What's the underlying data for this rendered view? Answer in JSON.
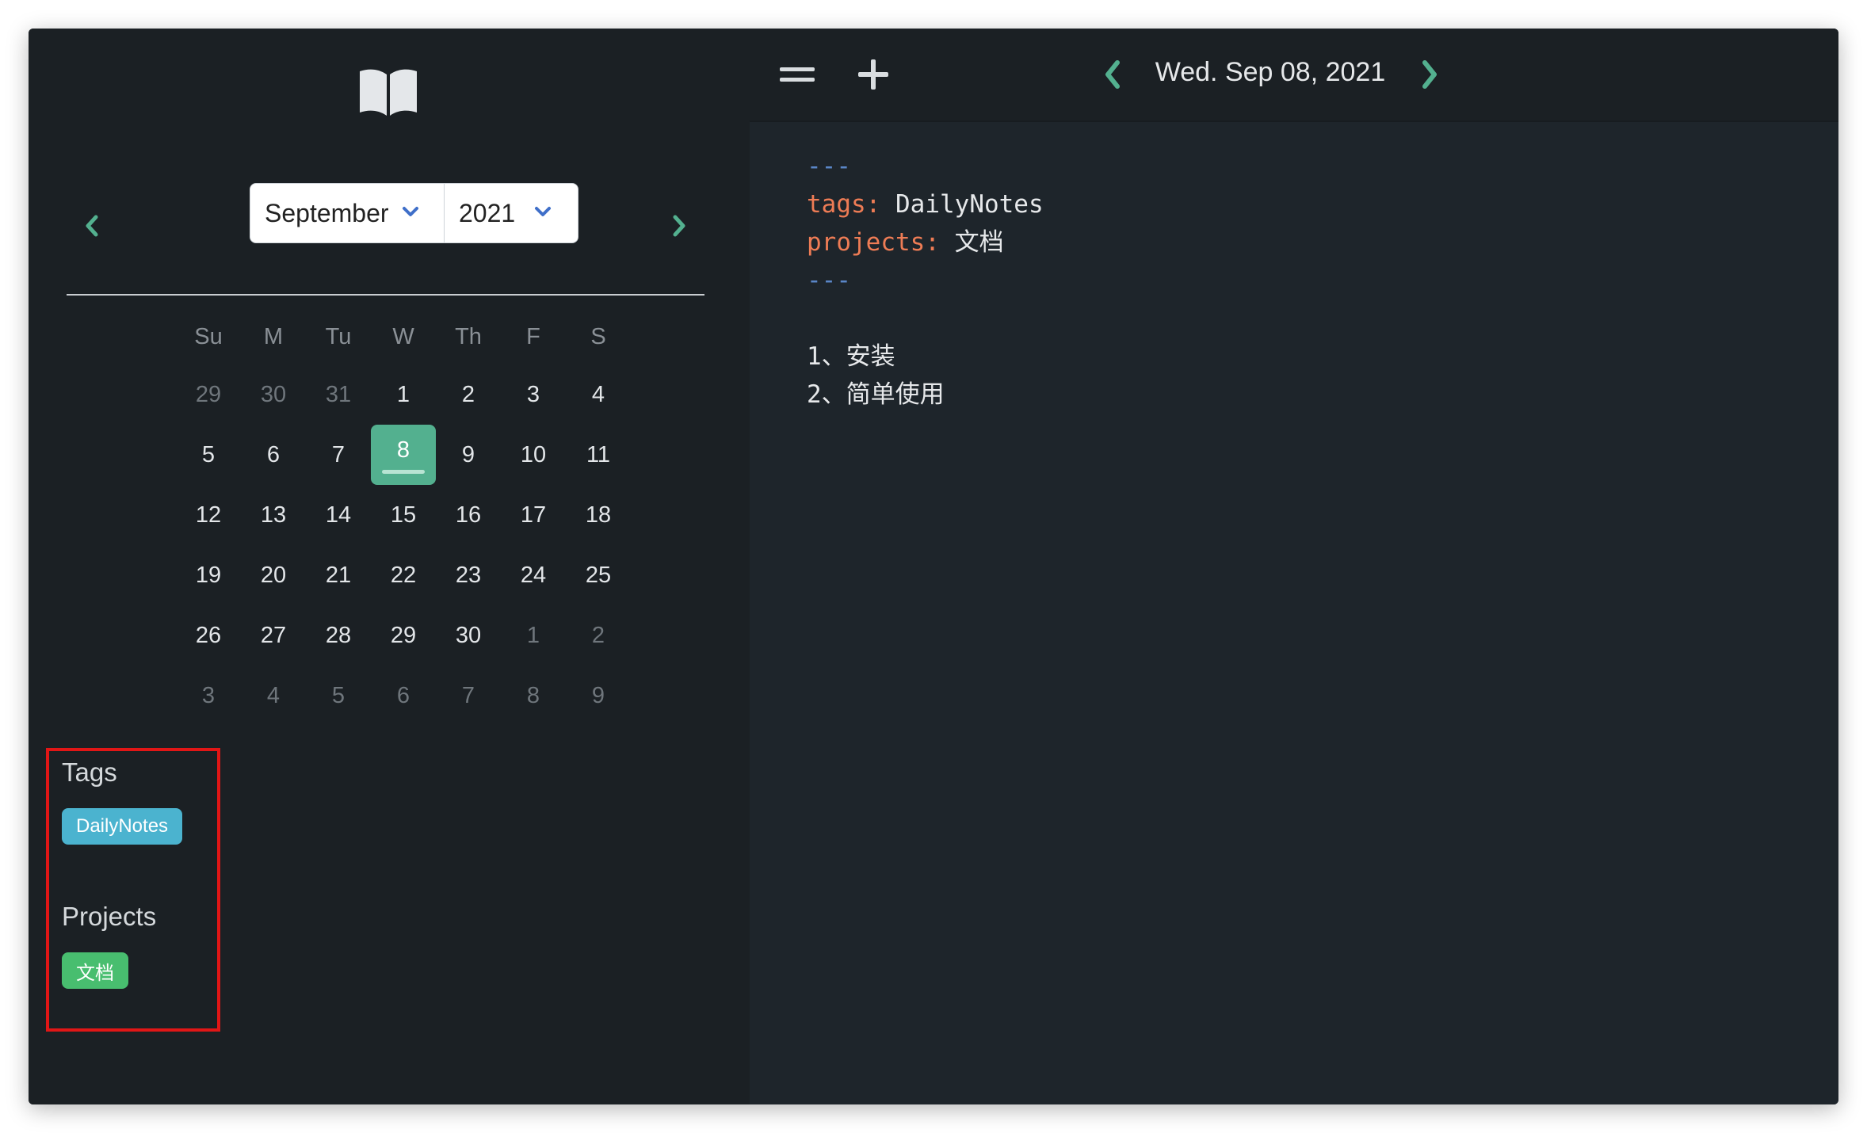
{
  "calendar": {
    "month": "September",
    "year": "2021",
    "weekdays": [
      "Su",
      "M",
      "Tu",
      "W",
      "Th",
      "F",
      "S"
    ],
    "weeks": [
      [
        "29",
        "30",
        "31",
        "1",
        "2",
        "3",
        "4"
      ],
      [
        "5",
        "6",
        "7",
        "8",
        "9",
        "10",
        "11"
      ],
      [
        "12",
        "13",
        "14",
        "15",
        "16",
        "17",
        "18"
      ],
      [
        "19",
        "20",
        "21",
        "22",
        "23",
        "24",
        "25"
      ],
      [
        "26",
        "27",
        "28",
        "29",
        "30",
        "1",
        "2"
      ],
      [
        "3",
        "4",
        "5",
        "6",
        "7",
        "8",
        "9"
      ]
    ],
    "selected_day": "8"
  },
  "sidebar": {
    "tags_title": "Tags",
    "tags": [
      "DailyNotes"
    ],
    "projects_title": "Projects",
    "projects": [
      "文档"
    ]
  },
  "toolbar": {
    "date": "Wed. Sep 08, 2021"
  },
  "editor": {
    "separator": "---",
    "tags_key": "tags:",
    "tags_value": "DailyNotes",
    "projects_key": "projects:",
    "projects_value": "文档",
    "line1": "1、安装",
    "line2": "2、简单使用"
  },
  "colors": {
    "accent": "#53b08f",
    "tag_chip": "#4bb3cf",
    "project_chip": "#48be6f",
    "yaml_key": "#ee7c55",
    "yaml_separator": "#5a86c7",
    "highlight_box": "#e11616"
  },
  "icons": {
    "logo": "open-book-icon",
    "menu": "menu-icon",
    "add": "plus-icon",
    "prev": "chevron-left-icon",
    "next": "chevron-right-icon",
    "save": "save-icon",
    "delete": "trash-icon",
    "more": "more-vertical-icon"
  }
}
